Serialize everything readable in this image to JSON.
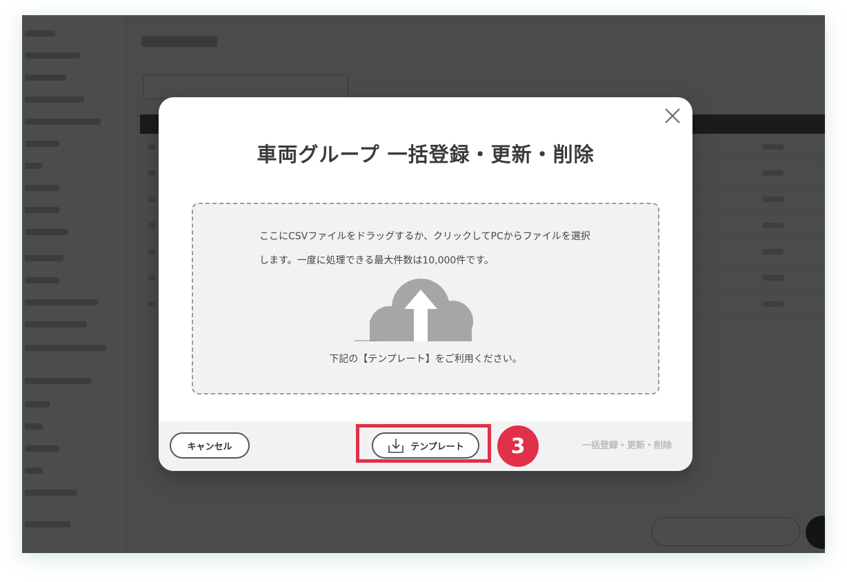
{
  "modal": {
    "title": "車両グループ 一括登録・更新・削除",
    "close_icon": "close-icon",
    "dropzone": {
      "instruction": "ここにCSVファイルをドラッグするか、クリックしてPCからファイルを選択します。一度に処理できる最大件数は10,000件です。",
      "icon": "cloud-upload-icon",
      "note": "下記の【テンプレート】をご利用ください。"
    },
    "footer": {
      "cancel_label": "キャンセル",
      "template_label": "テンプレート",
      "template_icon": "download-icon",
      "submit_label": "一括登録・更新・削除"
    }
  },
  "annotation": {
    "step_number": "3",
    "color": "#e0304a"
  },
  "colors": {
    "overlay": "#000000",
    "modal_bg": "#ffffff",
    "footer_bg": "#f2f2f2",
    "disabled_text": "#b9b9b9"
  }
}
